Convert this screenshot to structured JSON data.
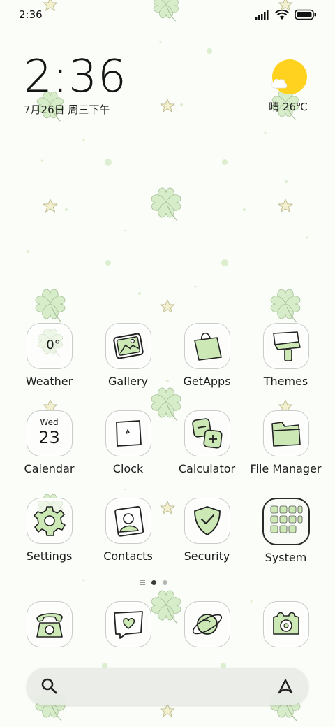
{
  "status_bar": {
    "time": "2:36",
    "icons": [
      "signal-icon",
      "wifi-icon",
      "battery-icon"
    ]
  },
  "clock_widget": {
    "time": "2:36",
    "date": "7月26日 周三下午"
  },
  "weather_widget": {
    "condition_icon": "sun-cloud-icon",
    "text": "晴 26℃"
  },
  "apps": [
    {
      "label": "Weather",
      "icon": "weather-icon",
      "icon_text": "0°"
    },
    {
      "label": "Gallery",
      "icon": "gallery-icon"
    },
    {
      "label": "GetApps",
      "icon": "shopping-bag-icon"
    },
    {
      "label": "Themes",
      "icon": "brush-icon"
    },
    {
      "label": "Calendar",
      "icon": "calendar-icon",
      "icon_day": "Wed",
      "icon_date": "23"
    },
    {
      "label": "Clock",
      "icon": "clock-icon"
    },
    {
      "label": "Calculator",
      "icon": "calculator-icon"
    },
    {
      "label": "File Manager",
      "icon": "folder-icon"
    },
    {
      "label": "Settings",
      "icon": "gear-icon"
    },
    {
      "label": "Contacts",
      "icon": "contact-icon"
    },
    {
      "label": "Security",
      "icon": "shield-icon"
    },
    {
      "label": "System",
      "icon": "folder-grid-icon"
    }
  ],
  "page_indicator": {
    "pages": 2,
    "current": 1
  },
  "dock": [
    {
      "icon": "phone-icon"
    },
    {
      "icon": "message-icon"
    },
    {
      "icon": "browser-icon"
    },
    {
      "icon": "camera-icon"
    }
  ],
  "search_bar": {
    "search_icon": "search-icon",
    "assistant_icon": "assistant-icon"
  },
  "colors": {
    "background": "#fbfdf8",
    "clover": "#d7ecc9",
    "clover_stroke": "#a8c09a",
    "accent_green": "#cbe8b5",
    "sun": "#ffd21f",
    "star": "#f2f0cf"
  }
}
